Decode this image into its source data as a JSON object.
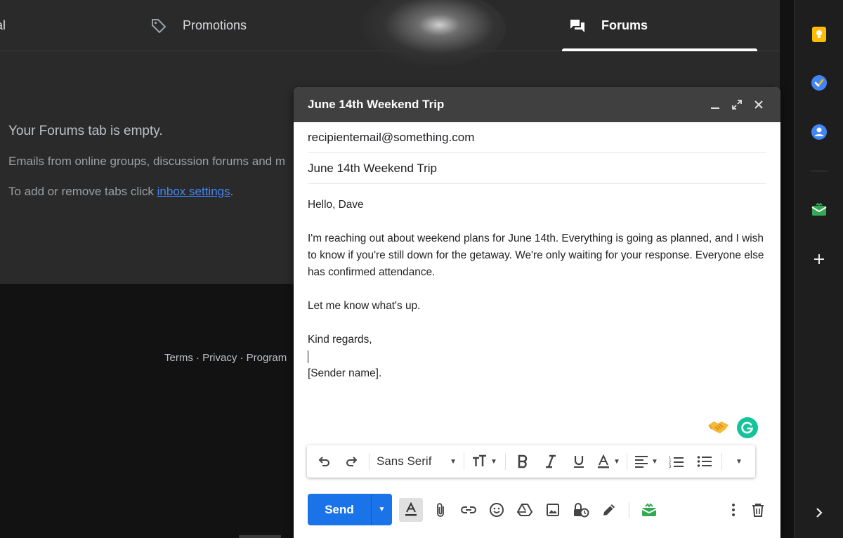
{
  "tabs": {
    "social_partial": "al",
    "promotions": "Promotions",
    "forums": "Forums"
  },
  "empty_state": {
    "title": "Your Forums tab is empty.",
    "subtitle": "Emails from online groups, discussion forums and m",
    "tabs_prefix": "To add or remove tabs click ",
    "settings_link": "inbox settings",
    "tabs_suffix": "."
  },
  "footer": {
    "links": "Terms · Privacy · Program"
  },
  "compose": {
    "title": "June 14th Weekend Trip",
    "to": "recipientemail@something.com",
    "subject": "June 14th Weekend Trip",
    "body": {
      "greeting": "Hello, Dave",
      "paragraph": "I'm reaching out about weekend plans for June 14th. Everything is going as planned, and I wish to know if you're still down for the getaway. We're only waiting for your response. Everyone else has confirmed attendance.",
      "ask": "Let me know what's up.",
      "closing": "Kind regards,",
      "signature": "[Sender name]."
    },
    "toolbar": {
      "font": "Sans Serif"
    },
    "send_label": "Send"
  },
  "colors": {
    "send_blue": "#1a73e8",
    "link_blue": "#4285f4",
    "grammarly_green": "#15c39a",
    "header_gray": "#404040"
  },
  "icons": {
    "side_panel": [
      "keep-icon",
      "tasks-icon",
      "contacts-icon",
      "addon-icon",
      "add-icon",
      "expand-icon"
    ],
    "compose_header": [
      "minimize-icon",
      "fullscreen-icon",
      "close-icon"
    ]
  }
}
